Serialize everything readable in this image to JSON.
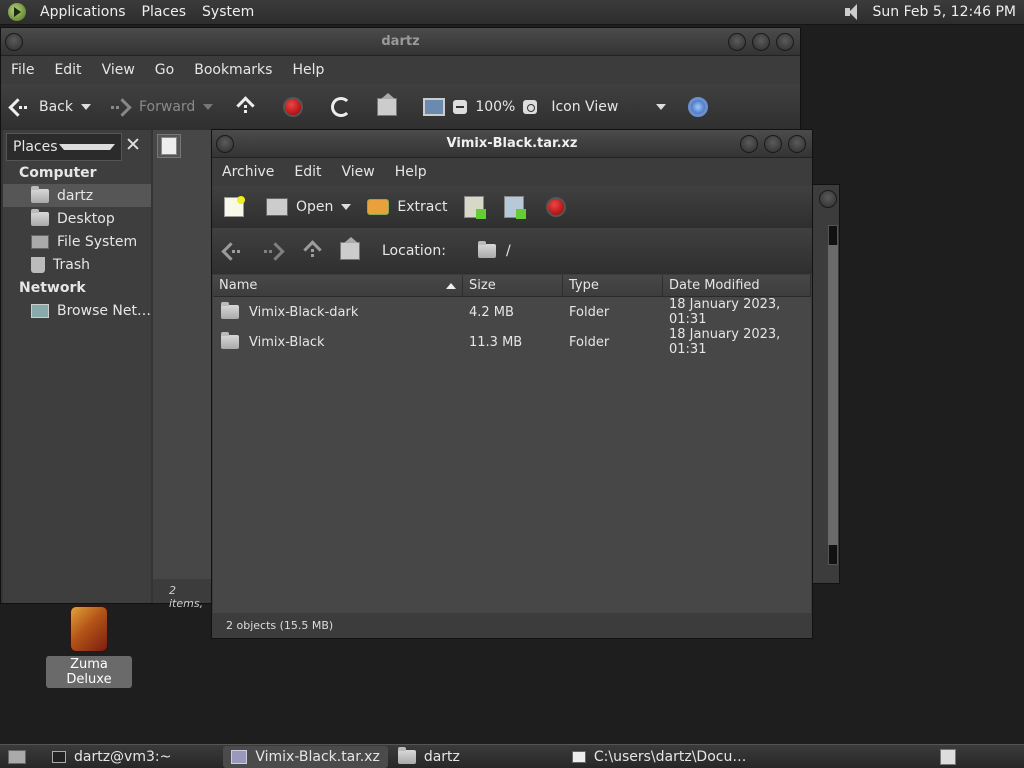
{
  "top_panel": {
    "menus": [
      "Applications",
      "Places",
      "System"
    ],
    "clock": "Sun Feb  5, 12:46 PM"
  },
  "desktop": {
    "icon_label": "Zuma Deluxe"
  },
  "nautilus": {
    "title": "dartz",
    "menus": [
      "File",
      "Edit",
      "View",
      "Go",
      "Bookmarks",
      "Help"
    ],
    "toolbar": {
      "back": "Back",
      "forward": "Forward",
      "zoom": "100%",
      "view_mode": "Icon View"
    },
    "sidebar": {
      "selector": "Places",
      "section_computer": "Computer",
      "computer_items": [
        {
          "label": "dartz",
          "icon": "home-folder-icon"
        },
        {
          "label": "Desktop",
          "icon": "desktop-folder-icon"
        },
        {
          "label": "File System",
          "icon": "drive-icon"
        },
        {
          "label": "Trash",
          "icon": "trash-icon"
        }
      ],
      "section_network": "Network",
      "network_items": [
        {
          "label": "Browse Net…",
          "icon": "network-icon"
        }
      ]
    },
    "status": "2 items,"
  },
  "file_roller": {
    "title": "Vimix-Black.tar.xz",
    "menus": [
      "Archive",
      "Edit",
      "View",
      "Help"
    ],
    "toolbar": {
      "open": "Open",
      "extract": "Extract"
    },
    "location_label": "Location:",
    "location_value": "/",
    "columns": {
      "name": "Name",
      "size": "Size",
      "type": "Type",
      "date": "Date Modified"
    },
    "rows": [
      {
        "name": "Vimix-Black-dark",
        "size": "4.2 MB",
        "type": "Folder",
        "date": "18 January 2023, 01:31"
      },
      {
        "name": "Vimix-Black",
        "size": "11.3 MB",
        "type": "Folder",
        "date": "18 January 2023, 01:31"
      }
    ],
    "status": "2 objects (15.5 MB)"
  },
  "taskbar": {
    "tasks": [
      {
        "label": "dartz@vm3:~",
        "icon": "terminal-icon"
      },
      {
        "label": "Vimix-Black.tar.xz",
        "icon": "archive-icon",
        "active": true
      },
      {
        "label": "dartz",
        "icon": "folder-icon"
      },
      {
        "label": "C:\\users\\dartz\\Docu…",
        "icon": "7z-icon"
      }
    ]
  },
  "colors": {
    "panel": "#333433",
    "window": "#3b3c3b",
    "list_bg": "#464746",
    "stop_red": "#cc2222"
  }
}
